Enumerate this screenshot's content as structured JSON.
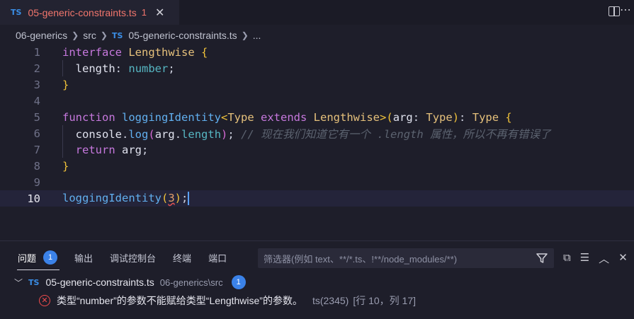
{
  "tab": {
    "lang": "TS",
    "filename": "05-generic-constraints.ts",
    "problem_count": "1",
    "close": "✕"
  },
  "breadcrumb": {
    "folder": "06-generics",
    "subfolder": "src",
    "lang": "TS",
    "file": "05-generic-constraints.ts",
    "ellipsis": "..."
  },
  "editor": {
    "line_numbers": [
      "1",
      "2",
      "3",
      "4",
      "5",
      "6",
      "7",
      "8",
      "9",
      "10"
    ],
    "active_line": "10",
    "lines": {
      "l1": [
        "interface",
        "Lengthwise",
        "{"
      ],
      "l2": [
        "length",
        ":",
        "number",
        ";"
      ],
      "l3": [
        "}"
      ],
      "l5": [
        "function",
        "loggingIdentity",
        "<",
        "Type",
        "extends",
        "Lengthwise",
        ">",
        "(",
        "arg",
        ":",
        "Type",
        ")",
        ":",
        "Type",
        "{"
      ],
      "l6": [
        "console",
        ".",
        "log",
        "(",
        "arg",
        ".",
        "length",
        ")",
        ";",
        "// 现在我们知道它有一个 .length 属性，所以不再有错误了"
      ],
      "l7": [
        "return",
        "arg",
        ";"
      ],
      "l8": [
        "}"
      ],
      "l10": [
        "loggingIdentity",
        "(",
        "3",
        ")",
        ";"
      ]
    }
  },
  "panel": {
    "tabs": {
      "problems": "问题",
      "problems_count": "1",
      "output": "输出",
      "debug_console": "调试控制台",
      "terminal": "终端",
      "ports": "端口"
    },
    "filter_placeholder": "筛选器(例如 text、**/*.ts、!**/node_modules/**)",
    "problem_file": {
      "lang": "TS",
      "name": "05-generic-constraints.ts",
      "path": "06-generics\\src",
      "count": "1"
    },
    "problem": {
      "message": "类型“number”的参数不能赋给类型“Lengthwise”的参数。",
      "source": "ts(2345)",
      "position": "[行 10，列 17]"
    }
  }
}
